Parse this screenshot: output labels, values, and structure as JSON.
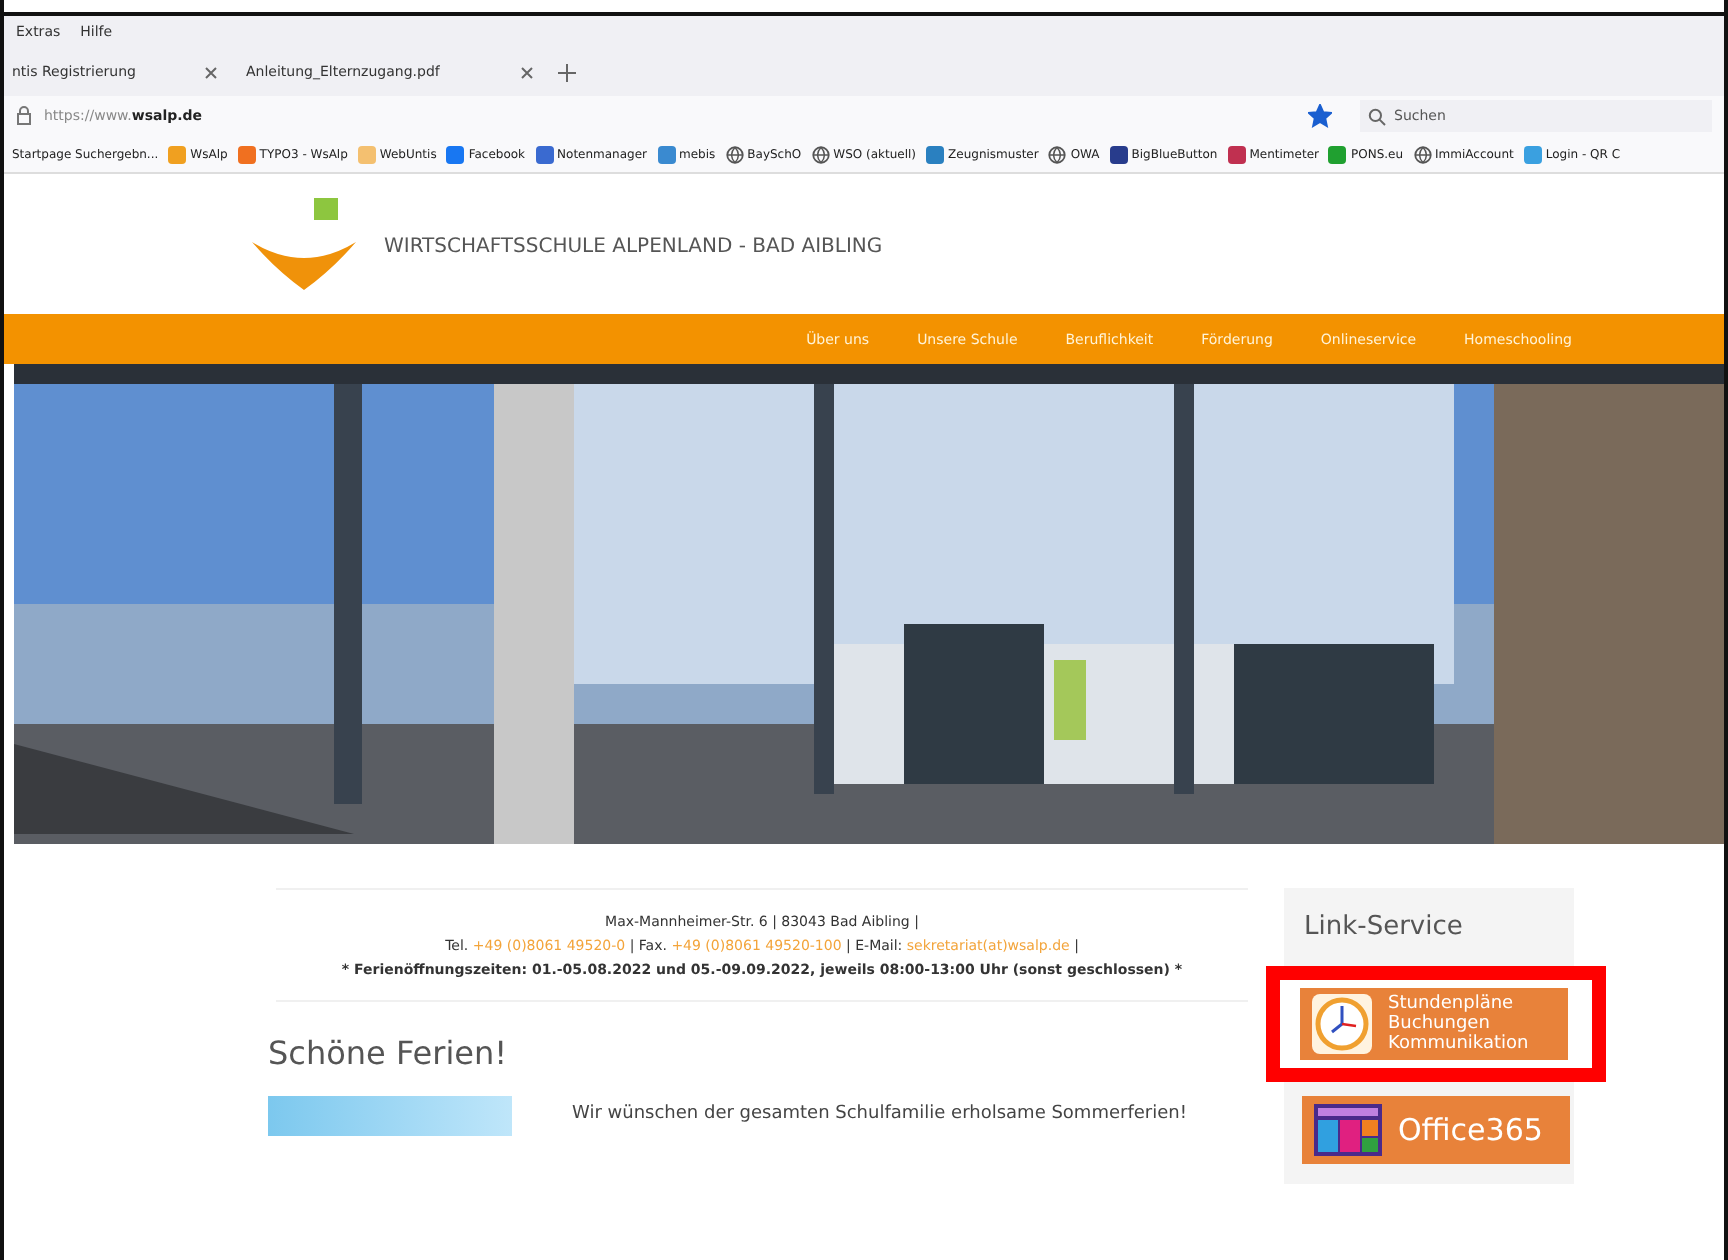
{
  "menu_bar": {
    "items": [
      "Extras",
      "Hilfe"
    ]
  },
  "tabs": [
    {
      "label": "ntis Registrierung"
    },
    {
      "label": "Anleitung_Elternzugang.pdf"
    }
  ],
  "address_bar": {
    "prefix": "https://www.",
    "domain": "wsalp.de",
    "bookmarked": true
  },
  "search": {
    "placeholder": "Suchen"
  },
  "bookmarks": [
    {
      "label": "Startpage Suchergebn...",
      "kind": "none"
    },
    {
      "label": "WsAlp",
      "kind": "app",
      "color": "#f0a020"
    },
    {
      "label": "TYPO3 - WsAlp",
      "kind": "app",
      "color": "#f07020"
    },
    {
      "label": "WebUntis",
      "kind": "app",
      "color": "#f4c070"
    },
    {
      "label": "Facebook",
      "kind": "app",
      "color": "#1877f2"
    },
    {
      "label": "Notenmanager",
      "kind": "app",
      "color": "#3a6ad0"
    },
    {
      "label": "mebis",
      "kind": "app",
      "color": "#3a8ad0"
    },
    {
      "label": "BaySchO",
      "kind": "globe"
    },
    {
      "label": "WSO (aktuell)",
      "kind": "globe"
    },
    {
      "label": "Zeugnismuster",
      "kind": "app",
      "color": "#2a80c0"
    },
    {
      "label": "OWA",
      "kind": "globe"
    },
    {
      "label": "BigBlueButton",
      "kind": "app",
      "color": "#283c8c"
    },
    {
      "label": "Mentimeter",
      "kind": "app",
      "color": "#c03050"
    },
    {
      "label": "PONS.eu",
      "kind": "app",
      "color": "#20a030"
    },
    {
      "label": "ImmiAccount",
      "kind": "globe"
    },
    {
      "label": "Login - QR C",
      "kind": "app",
      "color": "#3aa0e0"
    }
  ],
  "site": {
    "name": "WIRTSCHAFTSSCHULE ALPENLAND - BAD AIBLING",
    "nav": [
      "Über uns",
      "Unsere Schule",
      "Beruflichkeit",
      "Förderung",
      "Onlineservice",
      "Homeschooling"
    ],
    "hero": {
      "kind": "picture"
    },
    "contact": [
      [
        {
          "t": "Max-Mannheimer-Str. 6 | 83043 Bad Aibling |",
          "link": false
        }
      ],
      [
        {
          "t": "Tel.",
          "link": false
        },
        {
          "t": "+49 (0)8061 49520-0",
          "link": true
        },
        {
          "t": "| Fax.",
          "link": false
        },
        {
          "t": "+49 (0)8061 49520-100",
          "link": true
        },
        {
          "t": "| E-Mail:",
          "link": false
        },
        {
          "t": "sekretariat(at)wsalp.de",
          "link": true
        },
        {
          "t": "|",
          "link": false
        }
      ],
      [
        {
          "t": "* Ferienöffnungszeiten: 01.-05.08.2022 und 05.-09.09.2022, jeweils 08:00-13:00 Uhr (sonst geschlossen) *",
          "link": false
        }
      ]
    ],
    "heading": "Schöne Ferien!",
    "news_text": "Wir wünschen der gesamten Schulfamilie erholsame Sommerferien!",
    "sidebar": {
      "title": "Link-Service",
      "links": [
        {
          "lines": [
            "Stundenpläne",
            "Buchungen",
            "Kommunikation"
          ],
          "kind": "clock",
          "highlighted": true
        },
        {
          "lines": [
            "Office365"
          ],
          "kind": "tiles",
          "highlighted": false
        }
      ]
    }
  }
}
